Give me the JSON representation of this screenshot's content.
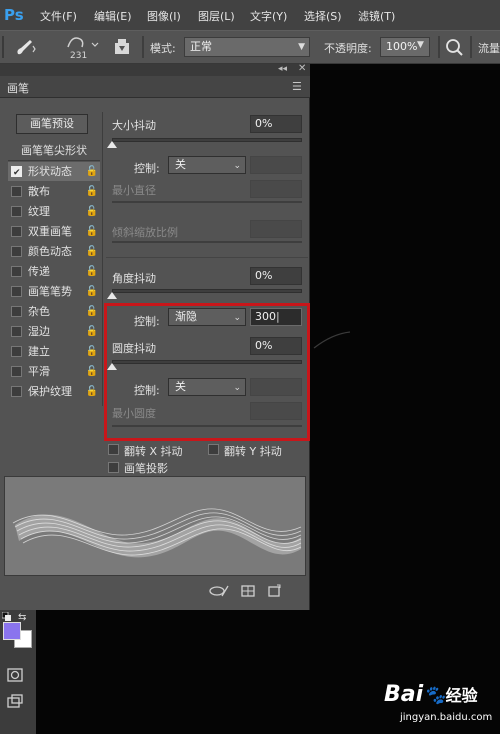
{
  "app": {
    "logo": "Ps"
  },
  "menu": [
    "文件(F)",
    "编辑(E)",
    "图像(I)",
    "图层(L)",
    "文字(Y)",
    "选择(S)",
    "滤镜(T)"
  ],
  "options_bar": {
    "brush_size": "231",
    "mode_label": "模式:",
    "mode_value": "正常",
    "opacity_label": "不透明度:",
    "opacity_value": "100%",
    "flow_label": "流量"
  },
  "panel": {
    "title": "画笔",
    "preset_button": "画笔预设",
    "tip_shape_header": "画笔笔尖形状",
    "items": [
      {
        "label": "形状动态",
        "checked": true,
        "selected": true
      },
      {
        "label": "散布",
        "checked": false
      },
      {
        "label": "纹理",
        "checked": false
      },
      {
        "label": "双重画笔",
        "checked": false
      },
      {
        "label": "颜色动态",
        "checked": false
      },
      {
        "label": "传递",
        "checked": false
      },
      {
        "label": "画笔笔势",
        "checked": false
      },
      {
        "label": "杂色",
        "checked": false
      },
      {
        "label": "湿边",
        "checked": false
      },
      {
        "label": "建立",
        "checked": false
      },
      {
        "label": "平滑",
        "checked": false
      },
      {
        "label": "保护纹理",
        "checked": false
      }
    ]
  },
  "settings": {
    "size_jitter_label": "大小抖动",
    "size_jitter_value": "0%",
    "control_label": "控制:",
    "control_off": "关",
    "min_diameter_label": "最小直径",
    "tilt_scale_label": "倾斜缩放比例",
    "angle_jitter_label": "角度抖动",
    "angle_jitter_value": "0%",
    "angle_control_value": "渐隐",
    "angle_control_number": "300",
    "roundness_jitter_label": "圆度抖动",
    "roundness_jitter_value": "0%",
    "roundness_control_value": "关",
    "min_roundness_label": "最小圆度",
    "flip_x_label": "翻转 X 抖动",
    "flip_y_label": "翻转 Y 抖动",
    "brush_projection_label": "画笔投影"
  },
  "colors": {
    "foreground": "#8a74ee",
    "background": "#ffffff",
    "highlight_box": "#c8161a"
  },
  "watermark": {
    "brand": "Bai",
    "brand2": "经验",
    "url": "jingyan.baidu.com"
  }
}
